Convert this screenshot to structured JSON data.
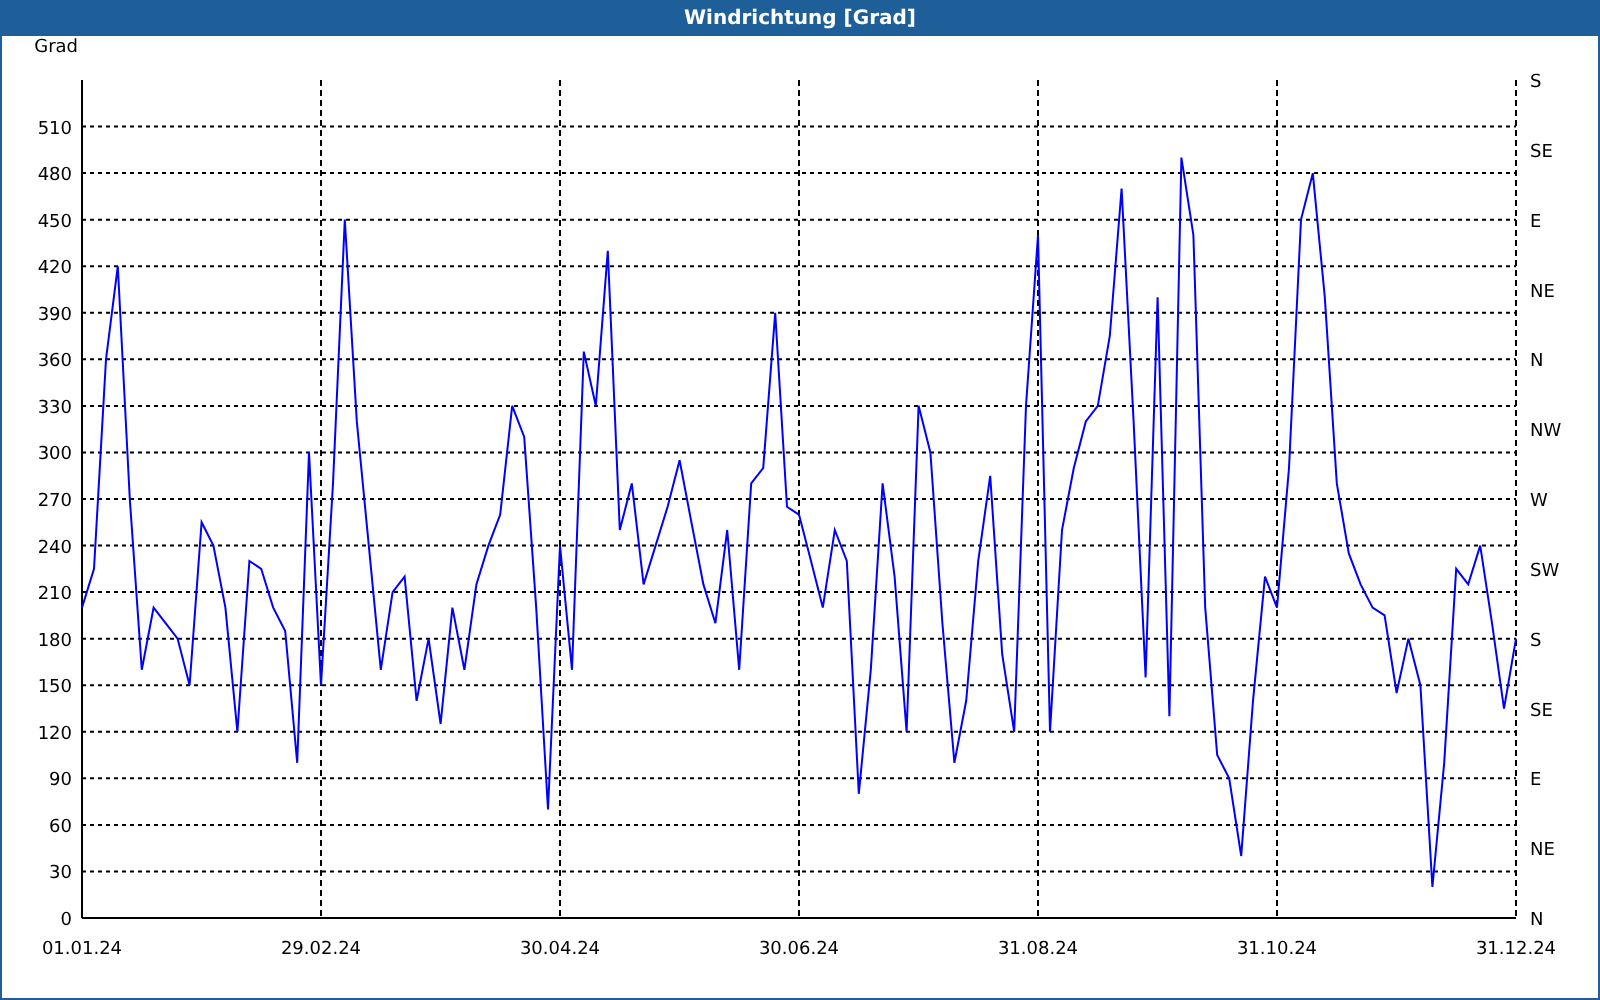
{
  "window": {
    "title": "Windrichtung [Grad]"
  },
  "chart": {
    "right_labels": [
      "S",
      "SE",
      "E",
      "NE",
      "N",
      "NW",
      "W",
      "SW",
      "S",
      "SE",
      "E",
      "NE",
      "N"
    ],
    "chart_data": {
      "type": "line",
      "ylabel": "Grad",
      "grid": true,
      "ylim": [
        0,
        540
      ],
      "yticks": [
        0,
        30,
        60,
        90,
        120,
        150,
        180,
        210,
        240,
        270,
        300,
        330,
        360,
        390,
        420,
        450,
        480,
        510
      ],
      "categories": [
        "01.01.24",
        null,
        null,
        null,
        null,
        null,
        null,
        null,
        null,
        null,
        null,
        null,
        null,
        null,
        null,
        null,
        null,
        null,
        null,
        null,
        "29.02.24",
        null,
        null,
        null,
        null,
        null,
        null,
        null,
        null,
        null,
        null,
        null,
        null,
        null,
        null,
        null,
        null,
        null,
        null,
        null,
        "30.04.24",
        null,
        null,
        null,
        null,
        null,
        null,
        null,
        null,
        null,
        null,
        null,
        null,
        null,
        null,
        null,
        null,
        null,
        null,
        null,
        "30.06.24",
        null,
        null,
        null,
        null,
        null,
        null,
        null,
        null,
        null,
        null,
        null,
        null,
        null,
        null,
        null,
        null,
        null,
        null,
        null,
        "31.08.24",
        null,
        null,
        null,
        null,
        null,
        null,
        null,
        null,
        null,
        null,
        null,
        null,
        null,
        null,
        null,
        null,
        null,
        null,
        null,
        "31.10.24",
        null,
        null,
        null,
        null,
        null,
        null,
        null,
        null,
        null,
        null,
        null,
        null,
        null,
        null,
        null,
        null,
        null,
        null,
        null,
        "31.12.24"
      ],
      "series": [
        {
          "color": "#0000ff",
          "values": [
            200,
            225,
            360,
            420,
            270,
            160,
            200,
            190,
            180,
            150,
            255,
            240,
            200,
            120,
            230,
            225,
            200,
            185,
            100,
            300,
            150,
            280,
            450,
            320,
            240,
            160,
            210,
            220,
            140,
            180,
            125,
            200,
            160,
            215,
            240,
            260,
            330,
            310,
            200,
            70,
            240,
            160,
            365,
            330,
            430,
            250,
            280,
            215,
            240,
            265,
            295,
            255,
            215,
            190,
            250,
            160,
            280,
            290,
            390,
            265,
            260,
            230,
            200,
            250,
            230,
            80,
            160,
            280,
            220,
            120,
            330,
            300,
            190,
            100,
            140,
            230,
            285,
            170,
            120,
            330,
            440,
            120,
            250,
            290,
            320,
            330,
            375,
            470,
            320,
            155,
            400,
            130,
            490,
            440,
            200,
            105,
            90,
            40,
            140,
            220,
            200,
            290,
            450,
            480,
            400,
            280,
            235,
            215,
            200,
            195,
            145,
            180,
            150,
            20,
            100,
            225,
            215,
            240,
            190,
            135,
            180
          ]
        }
      ]
    }
  }
}
